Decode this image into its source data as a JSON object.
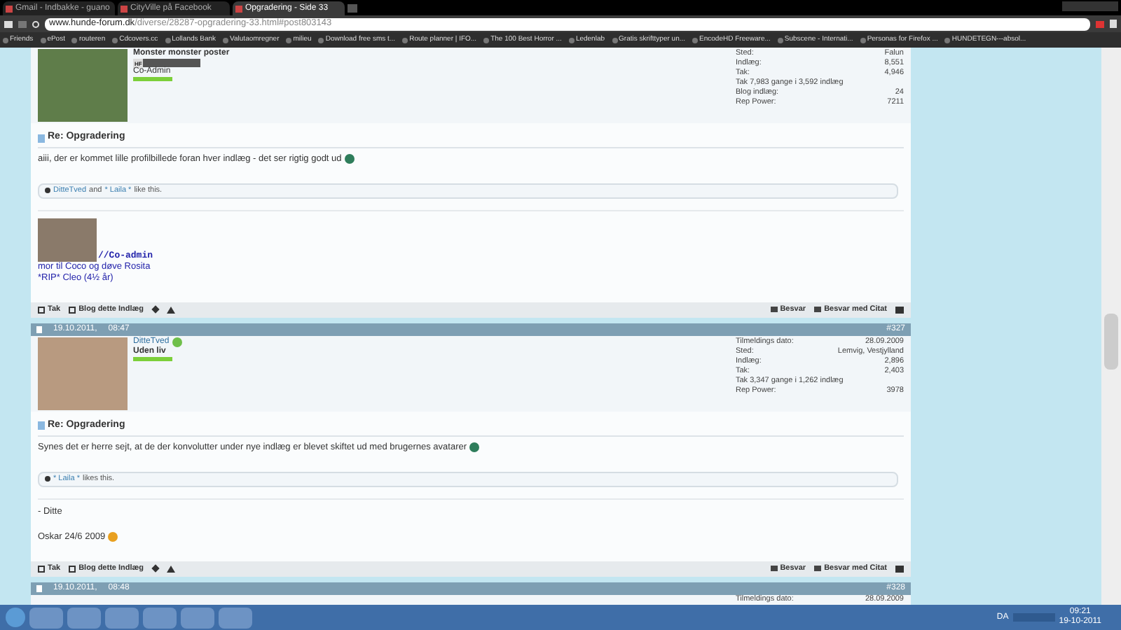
{
  "browser": {
    "tabs": [
      {
        "title": "Gmail - Indbakke - guano",
        "selected": false
      },
      {
        "title": "CityVille på Facebook",
        "selected": false
      },
      {
        "title": "Opgradering - Side 33",
        "selected": true
      }
    ],
    "address": {
      "host": "www.hunde-forum.dk",
      "path": "/diverse/28287-opgradering-33.html#post803143"
    },
    "bookmarks": [
      "Friends",
      "ePost",
      "routeren",
      "Cdcovers.cc",
      "Lollands Bank",
      "Valutaomregner",
      "milieu",
      "Download free sms t...",
      "Route planner | IFO...",
      "The 100 Best Horror ...",
      "Ledenlab",
      "Gratis skrifttyper un...",
      "EncodeHD Freeware...",
      "Subscene - Internati...",
      "Personas for Firefox ...",
      "HUNDETEGN---absol..."
    ]
  },
  "posts": [
    {
      "user": {
        "title": "Monster monster poster",
        "badge": "HF",
        "role": "Co-Admin",
        "stats": [
          {
            "label": "Sted:",
            "value": "Falun"
          },
          {
            "label": "Indlæg:",
            "value": "8,551"
          },
          {
            "label": "Tak:",
            "value": "4,946"
          },
          {
            "label": "Tak 7,983 gange i 3,592 indlæg"
          },
          {
            "label": "Blog indlæg:",
            "value": "24"
          },
          {
            "label": "Rep Power:",
            "value": "7211"
          }
        ]
      },
      "title": "Re: Opgradering",
      "body": "aiii, der er kommet lille profilbillede foran hver indlæg - det ser rigtig godt ud",
      "emoticon": true,
      "likes": {
        "names": [
          "DitteTved",
          "* Laila *"
        ],
        "joiner": "and",
        "suffix": "like this."
      },
      "signature": [
        {
          "kind": "image_caption",
          "text": "//Co-admin"
        },
        {
          "kind": "line",
          "text": "mor til Coco og døve Rosita"
        },
        {
          "kind": "line",
          "text": "*RIP* Cleo (4½ år)"
        }
      ],
      "footer": {
        "left": [
          "Tak",
          "Blog dette Indlæg"
        ],
        "right": [
          "Besvar",
          "Besvar med Citat"
        ]
      }
    },
    {
      "header": {
        "date": "19.10.2011,",
        "time": "08:47",
        "number": "#327"
      },
      "user": {
        "name": "DitteTved",
        "title": "Uden liv",
        "online": true,
        "stats": [
          {
            "label": "Tilmeldings dato:",
            "value": "28.09.2009"
          },
          {
            "label": "Sted:",
            "value": "Lemvig, Vestjylland"
          },
          {
            "label": "Indlæg:",
            "value": "2,896"
          },
          {
            "label": "Tak:",
            "value": "2,403"
          },
          {
            "label": "Tak 3,347 gange i 1,262 indlæg"
          },
          {
            "label": "Rep Power:",
            "value": "3978"
          }
        ]
      },
      "title": "Re: Opgradering",
      "body": "Synes det er herre sejt, at de der konvolutter under nye indlæg er blevet skiftet ud med brugernes avatarer",
      "emoticon": true,
      "likes": {
        "names": [
          "* Laila *"
        ],
        "suffix": "likes this."
      },
      "signature": [
        {
          "kind": "line",
          "text": "- Ditte"
        },
        {
          "kind": "smiley_line",
          "text": "Oskar 24/6 2009"
        }
      ],
      "footer": {
        "left": [
          "Tak",
          "Blog dette Indlæg"
        ],
        "right": [
          "Besvar",
          "Besvar med Citat"
        ]
      }
    },
    {
      "header": {
        "date": "19.10.2011,",
        "time": "08:48",
        "number": "#328"
      },
      "user": {
        "stats": [
          {
            "label": "Tilmeldings dato:",
            "value": "28.09.2009"
          }
        ]
      }
    }
  ],
  "taskbar": {
    "language": "DA",
    "time": "09:21",
    "date": "19-10-2011"
  }
}
